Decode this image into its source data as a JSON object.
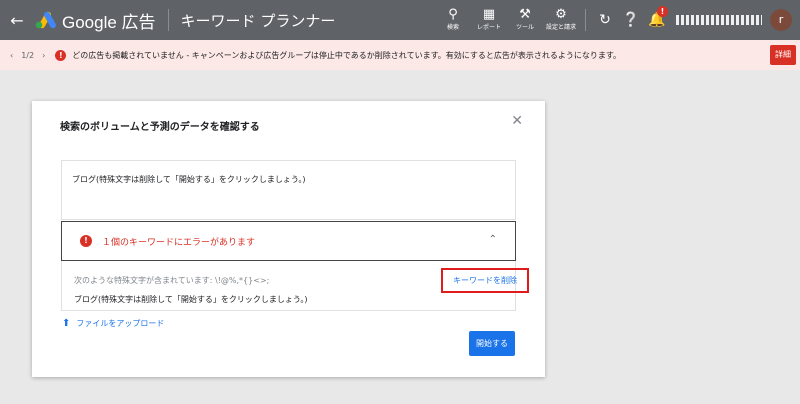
{
  "topbar": {
    "back_icon": "arrow-left-icon",
    "brand": "Google 広告",
    "app_title": "キーワード プランナー",
    "tools": [
      {
        "label": "検索",
        "icon": "search-icon"
      },
      {
        "label": "レポート",
        "icon": "report-icon"
      },
      {
        "label": "ツール",
        "icon": "wrench-icon"
      },
      {
        "label": "設定と請求",
        "icon": "gear-icon"
      }
    ],
    "notification_count": "!",
    "avatar_letter": "r"
  },
  "alert": {
    "page": "1/2",
    "message": "どの広告も掲載されていません - キャンペーンおよび広告グループは停止中であるか削除されています。有効にすると広告が表示されるようになります。",
    "detail_label": "詳細",
    "color": "#d93025"
  },
  "dialog": {
    "title": "検索のボリュームと予測のデータを確認する",
    "input_value": "ブログ(特殊文字は削除して「開始する」をクリックしましょう。)",
    "error_title": "１個のキーワードにエラーがあります",
    "chars_line": "次のような特殊文字が含まれています: \\!@%,*{}<>;",
    "remove_label": "キーワードを削除",
    "keyword_line": "ブログ(特殊文字は削除して「開始する」をクリックしましょう。)",
    "upload_label": "ファイルをアップロード",
    "start_label": "開始する",
    "accent": "#1a73e8"
  }
}
